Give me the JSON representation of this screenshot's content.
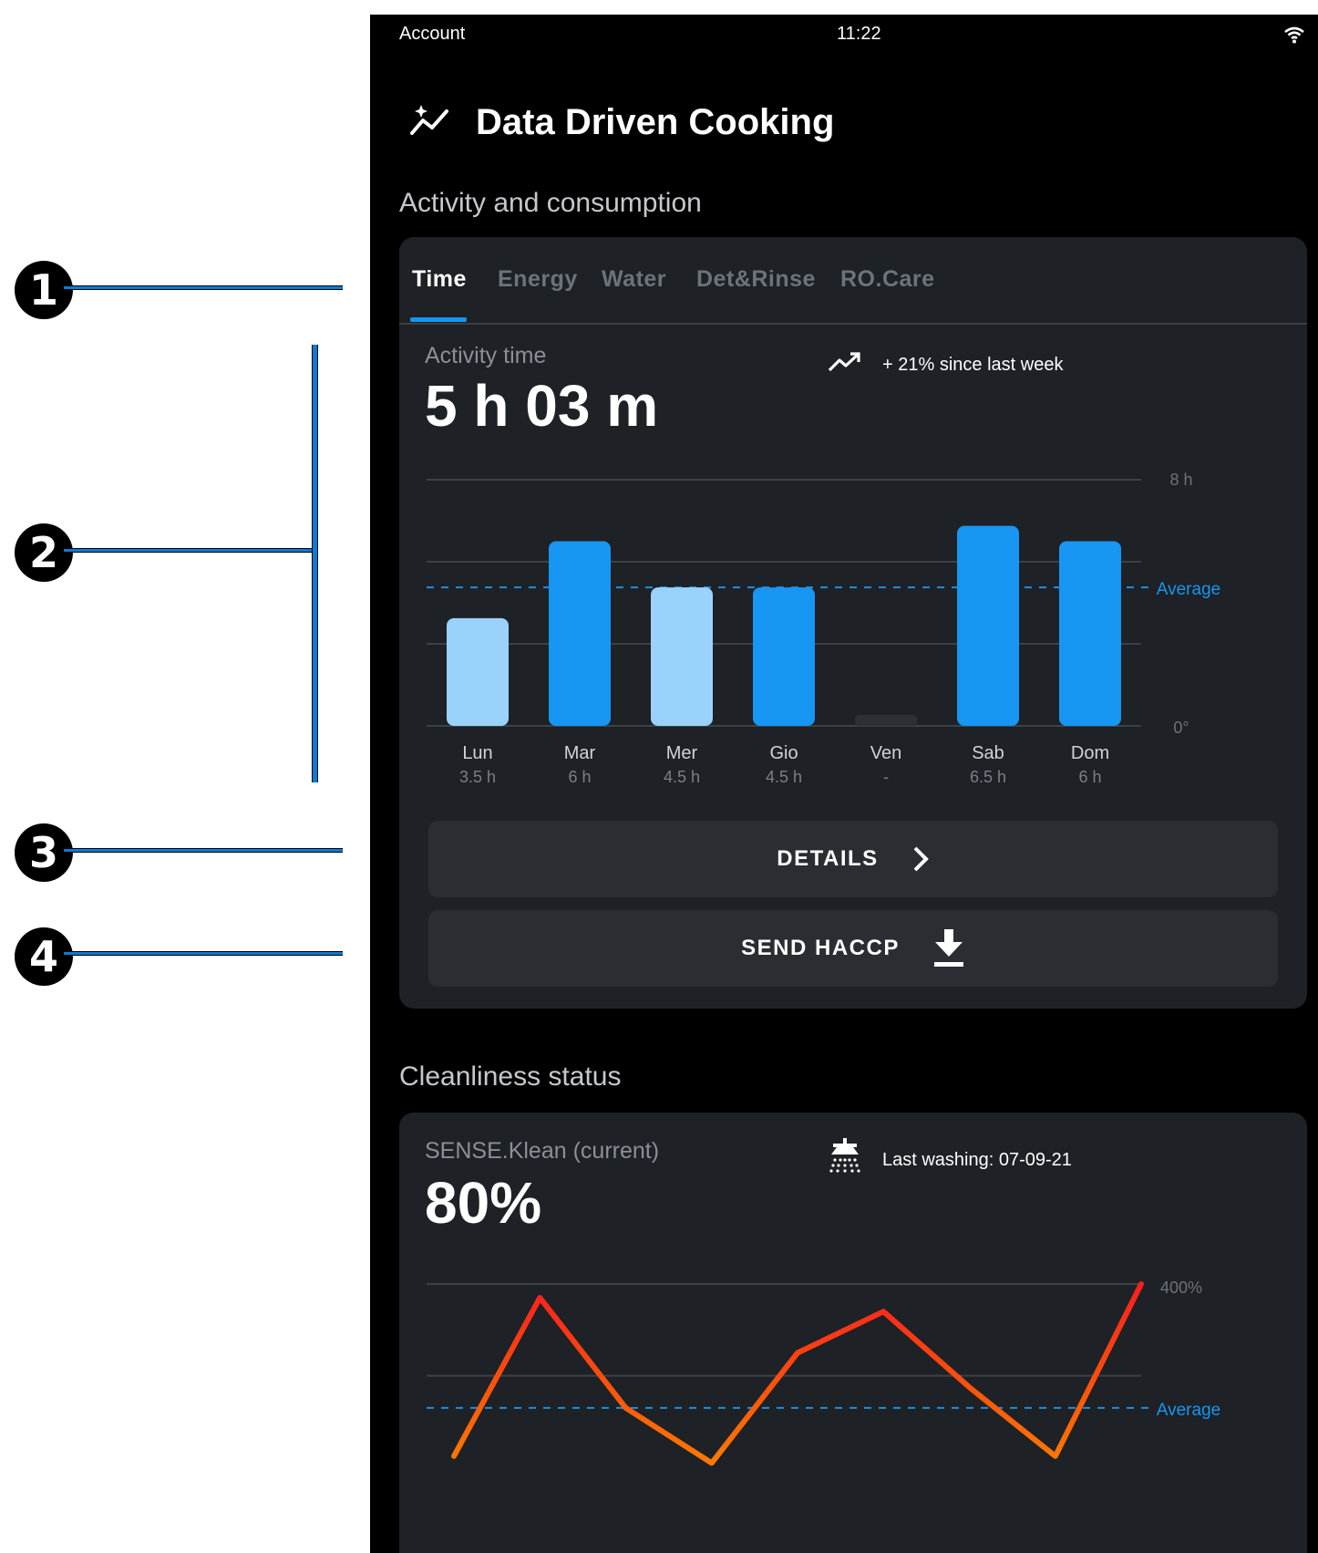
{
  "callouts": [
    "1",
    "2",
    "3",
    "4"
  ],
  "status_bar": {
    "account": "Account",
    "time": "11:22"
  },
  "app": {
    "title": "Data Driven Cooking"
  },
  "activity_section": {
    "label": "Activity and consumption",
    "tabs": [
      "Time",
      "Energy",
      "Water",
      "Det&Rinse",
      "RO.Care"
    ],
    "active_tab": "Time",
    "metric_label": "Activity time",
    "metric_value": "5 h 03 m",
    "trend_text": "+ 21% since last week",
    "details_label": "DETAILS",
    "haccp_label": "SEND HACCP"
  },
  "cleanliness_section": {
    "label": "Cleanliness status",
    "metric_label": "SENSE.Klean (current)",
    "metric_value": "80%",
    "washing_text": "Last washing: 07-09-21"
  },
  "colors": {
    "accent": "#1796f3",
    "bar_light": "#9bd2fb",
    "line_red": "#ff1e1e",
    "line_orange": "#ff7a00"
  },
  "chart_data": [
    {
      "type": "bar",
      "categories": [
        "Lun",
        "Mar",
        "Mer",
        "Gio",
        "Ven",
        "Sab",
        "Dom"
      ],
      "values": [
        3.5,
        6,
        4.5,
        4.5,
        0,
        6.5,
        6
      ],
      "value_labels": [
        "3.5 h",
        "6 h",
        "4.5 h",
        "4.5 h",
        "-",
        "6.5 h",
        "6 h"
      ],
      "highlight": [
        false,
        true,
        false,
        true,
        false,
        true,
        true
      ],
      "ylim": [
        0,
        8
      ],
      "y_tick_labels": {
        "top": "8 h",
        "bottom": "0°"
      },
      "average_label": "Average",
      "average": 4.5
    },
    {
      "type": "line",
      "y_tick_labels": {
        "top": "400%"
      },
      "average_label": "Average",
      "values": [
        150,
        380,
        220,
        140,
        300,
        360,
        250,
        150,
        400
      ],
      "ylim": [
        0,
        400
      ]
    }
  ]
}
